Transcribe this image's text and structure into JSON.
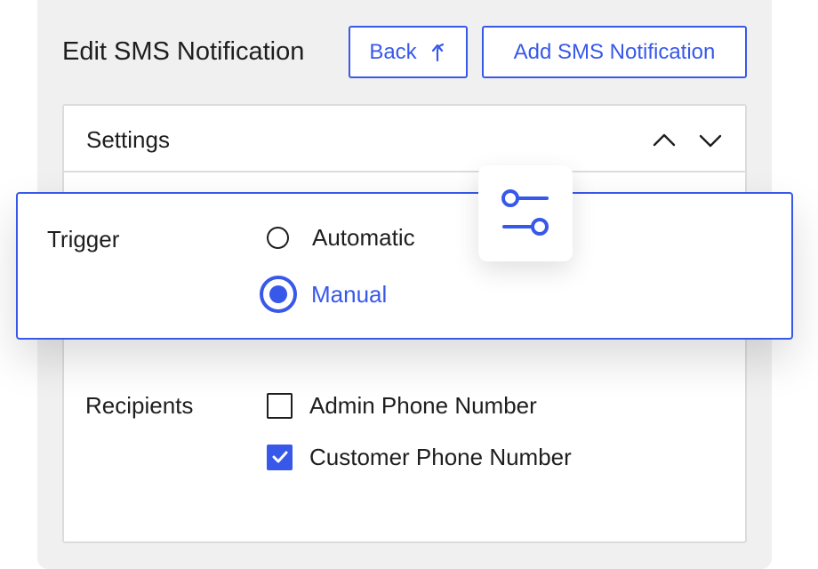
{
  "header": {
    "title": "Edit SMS Notification",
    "back_label": "Back",
    "add_label": "Add SMS Notification"
  },
  "card": {
    "title": "Settings"
  },
  "trigger": {
    "label": "Trigger",
    "options": [
      {
        "label": "Automatic",
        "selected": false
      },
      {
        "label": "Manual",
        "selected": true
      }
    ]
  },
  "recipients": {
    "label": "Recipients",
    "options": [
      {
        "label": "Admin Phone Number",
        "checked": false
      },
      {
        "label": "Customer Phone Number",
        "checked": true
      }
    ]
  },
  "icons": {
    "back": "arrow-up-return-icon",
    "collapse": "chevron-up-icon",
    "expand": "chevron-down-icon",
    "settings": "sliders-icon",
    "check": "checkmark-icon"
  },
  "colors": {
    "accent": "#3858e9",
    "text": "#1e1e1e",
    "panel_bg": "#f0f0f1",
    "border": "#dcdcde"
  }
}
